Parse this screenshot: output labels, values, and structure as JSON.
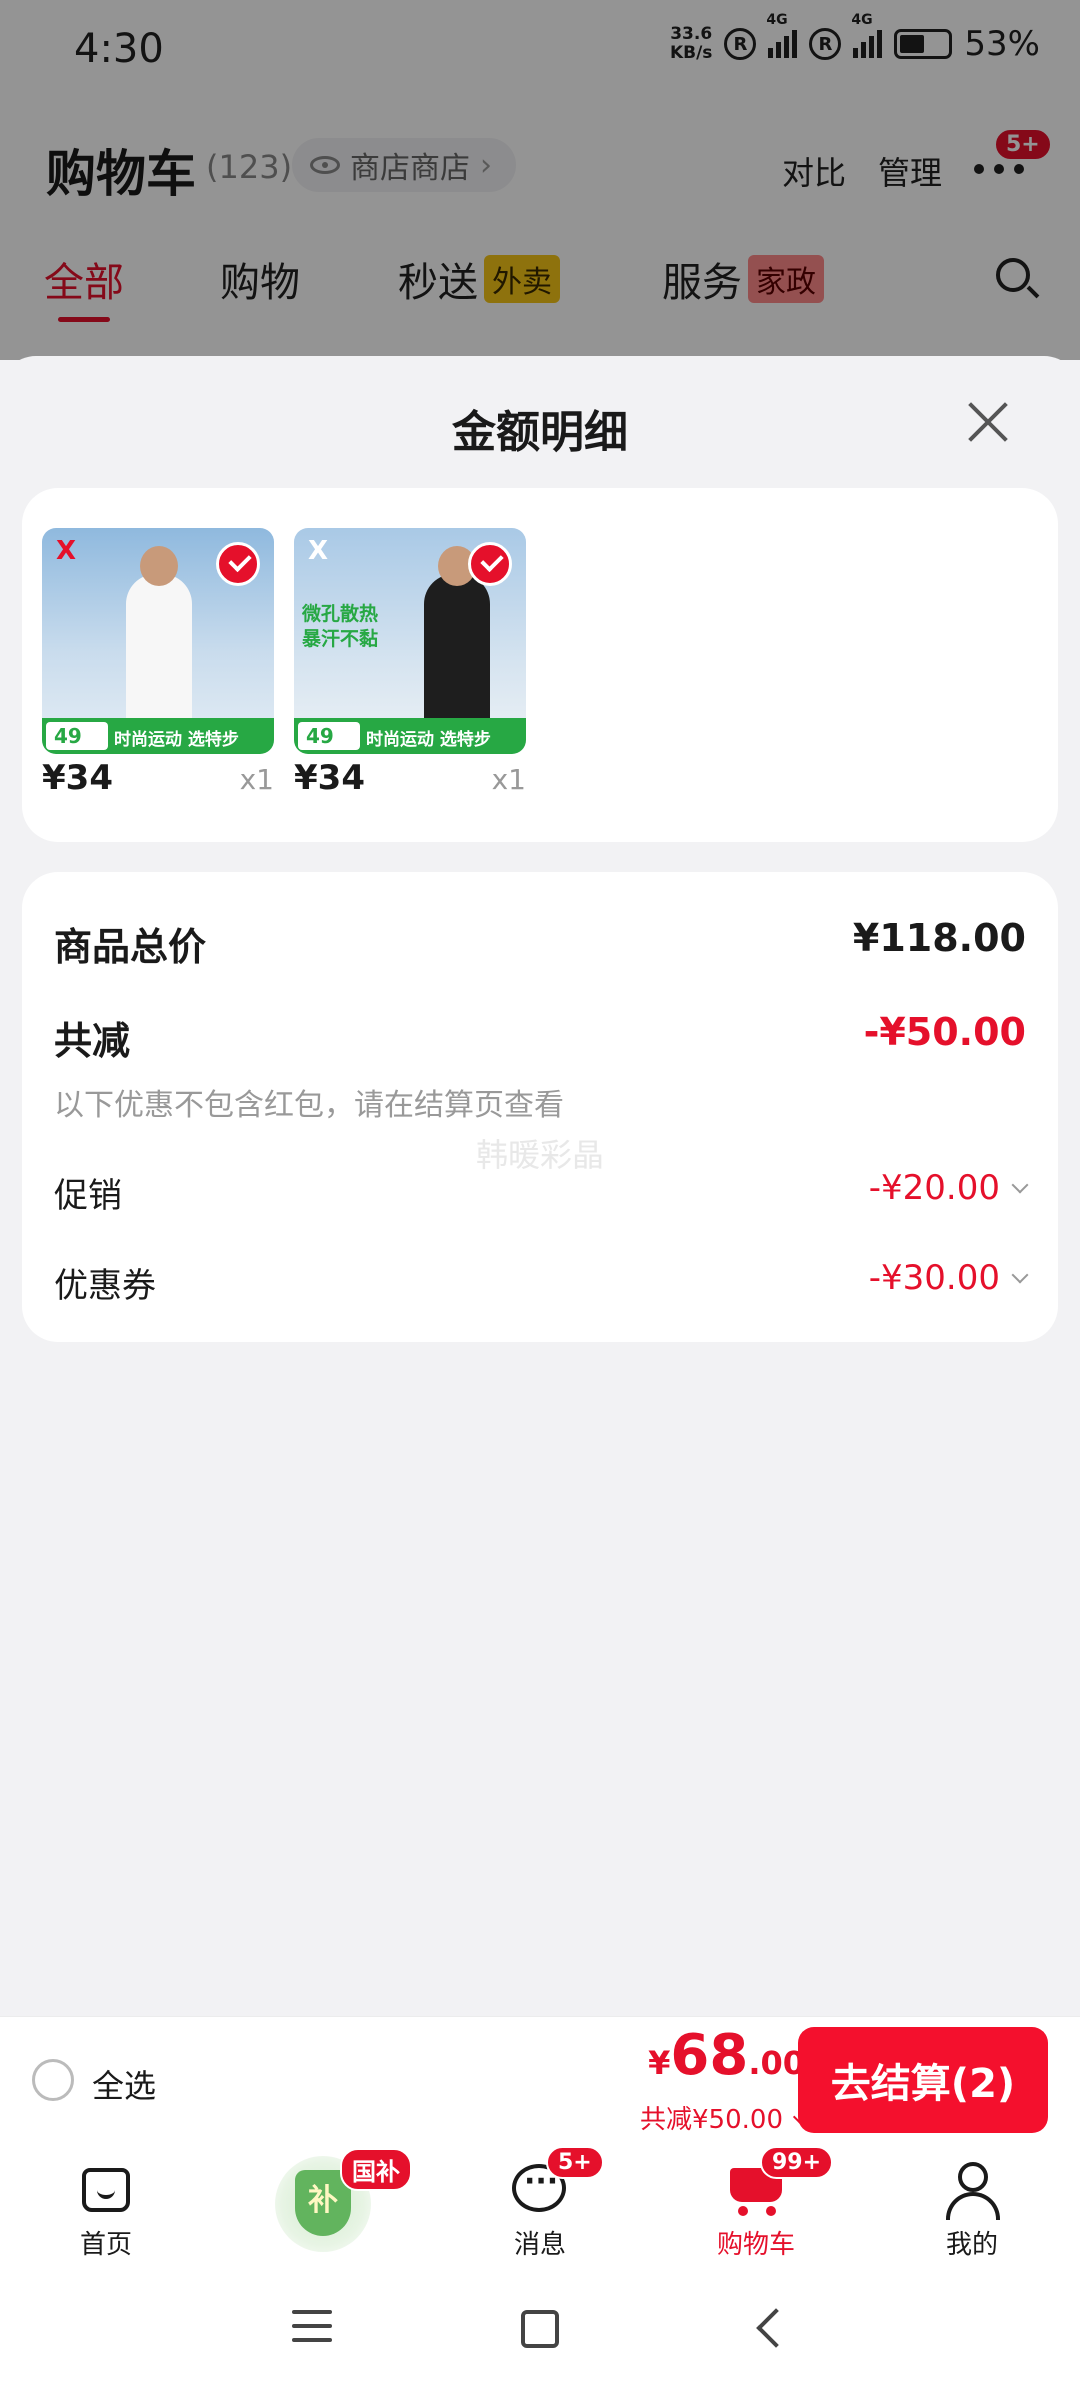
{
  "status_bar": {
    "time": "4:30",
    "net_speed_value": "33.6",
    "net_speed_unit": "KB/s",
    "r_icon": "R",
    "network_type": "4G",
    "battery_percent": "53%",
    "battery_level": 0.53
  },
  "header": {
    "title": "购物车",
    "count": "(123)",
    "shop_label": "商店商店",
    "compare": "对比",
    "manage": "管理",
    "more_badge": "5+"
  },
  "tabs": [
    {
      "label": "全部",
      "active": true
    },
    {
      "label": "购物"
    },
    {
      "label": "秒送",
      "tag": "外卖"
    },
    {
      "label": "服务",
      "tag": "家政"
    }
  ],
  "sheet": {
    "title": "金额明细",
    "products": [
      {
        "price": "¥34",
        "qty": "x1",
        "image_label": "49",
        "slogan": "时尚运动  选特步",
        "overlay": ""
      },
      {
        "price": "¥34",
        "qty": "x1",
        "image_label": "49",
        "slogan": "时尚运动  选特步",
        "overlay": "微孔散热\n暴汗不黏"
      }
    ],
    "summary": {
      "total_label": "商品总价",
      "total_value": "¥118.00",
      "reduce_label": "共减",
      "reduce_value": "-¥50.00",
      "note": "以下优惠不包含红包，请在结算页查看",
      "watermark": "韩暖彩晶",
      "promo_label": "促销",
      "promo_value": "-¥20.00",
      "coupon_label": "优惠券",
      "coupon_value": "-¥30.00"
    }
  },
  "checkout": {
    "select_all": "全选",
    "currency": "¥",
    "total_int": "68",
    "total_dec": ".00",
    "discount": "共减¥50.00",
    "button": "去结算(2)"
  },
  "bottom_nav": {
    "items": [
      {
        "label": "首页"
      },
      {
        "label": "",
        "badge": "国补",
        "icon_text": "补"
      },
      {
        "label": "消息",
        "badge": "5+"
      },
      {
        "label": "购物车",
        "badge": "99+",
        "active": true
      },
      {
        "label": "我的"
      }
    ]
  },
  "colors": {
    "accent": "#e5102b",
    "checkout_button": "#f4102d",
    "background": "#f2f2f4",
    "promo_green": "#27a844"
  }
}
